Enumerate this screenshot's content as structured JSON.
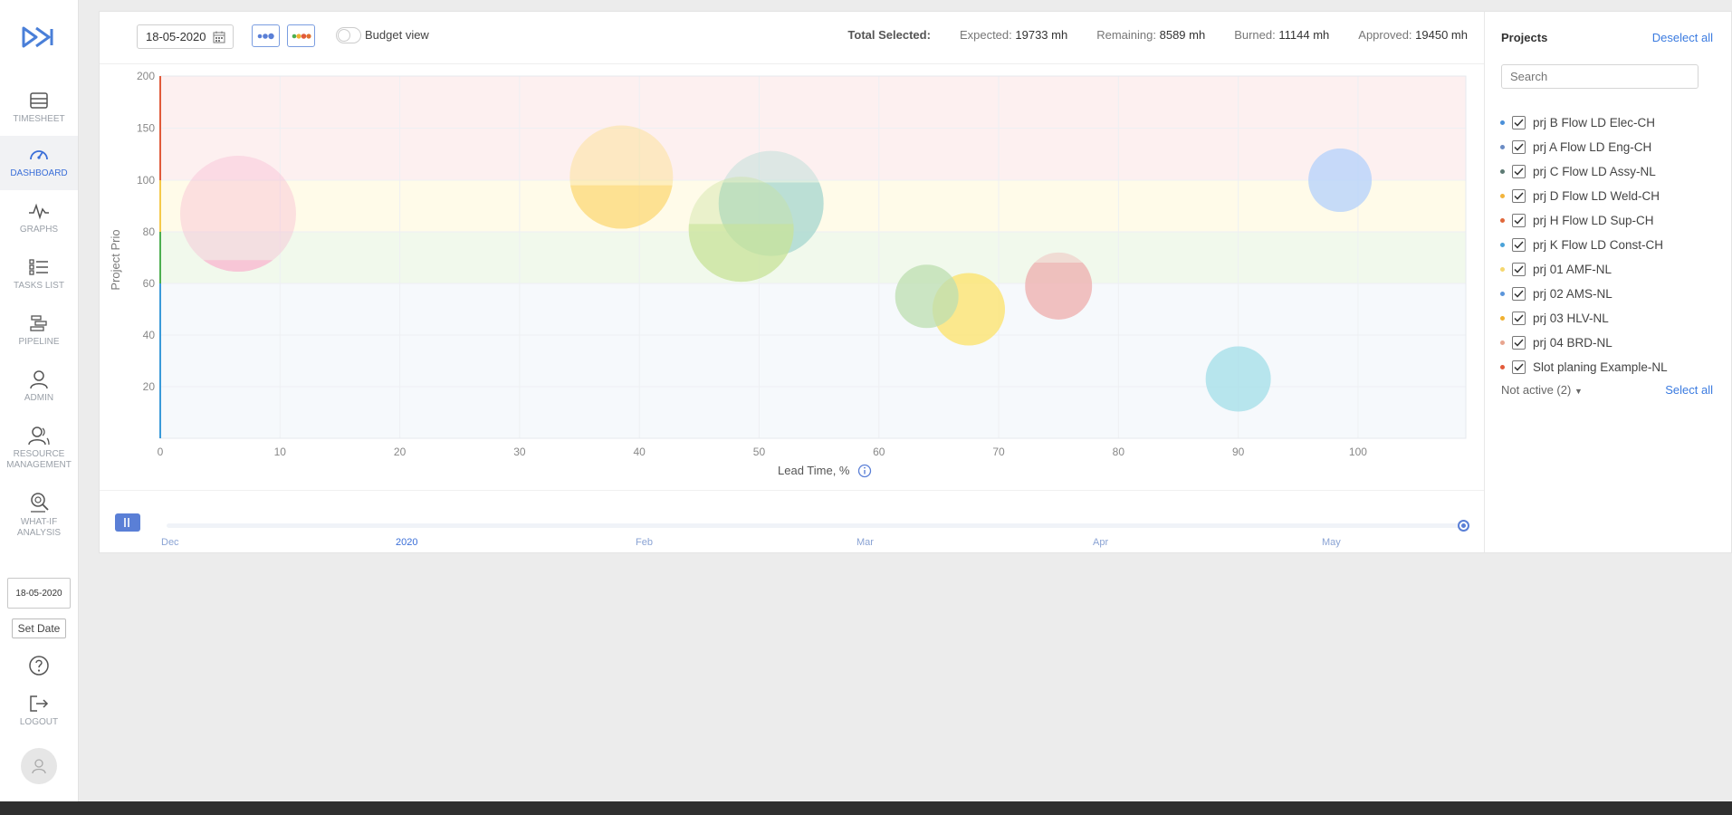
{
  "sidebar": {
    "items": [
      {
        "label": "TIMESHEET",
        "icon": "timesheet-icon"
      },
      {
        "label": "DASHBOARD",
        "icon": "dashboard-icon"
      },
      {
        "label": "GRAPHS",
        "icon": "graphs-icon"
      },
      {
        "label": "TASKS LIST",
        "icon": "tasks-list-icon"
      },
      {
        "label": "PIPELINE",
        "icon": "pipeline-icon"
      },
      {
        "label": "ADMIN",
        "icon": "admin-icon"
      },
      {
        "label": "RESOURCE MANAGEMENT",
        "icon": "resource-management-icon"
      },
      {
        "label": "WHAT-IF ANALYSIS",
        "icon": "what-if-analysis-icon"
      }
    ],
    "active": "DASHBOARD",
    "date_value": "18-05-2020",
    "set_date_label": "Set Date",
    "logout_label": "LOGOUT"
  },
  "toolbar": {
    "date_value": "18-05-2020",
    "budget_view_label": "Budget view",
    "budget_view_on": false,
    "total_selected_label": "Total Selected:",
    "expected_label": "Expected:",
    "expected_value": "19733 mh",
    "remaining_label": "Remaining:",
    "remaining_value": "8589 mh",
    "burned_label": "Burned:",
    "burned_value": "11144 mh",
    "approved_label": "Approved:",
    "approved_value": "19450 mh"
  },
  "chart_data": {
    "type": "scatter",
    "xlabel": "Lead Time, %",
    "ylabel": "Project Prio",
    "xlim": [
      0,
      109
    ],
    "ylim": [
      0,
      200
    ],
    "xticks": [
      0,
      10,
      20,
      30,
      40,
      50,
      60,
      70,
      80,
      90,
      100
    ],
    "yticks": [
      20,
      40,
      60,
      80,
      100,
      150,
      200
    ],
    "bands": [
      {
        "from": 100,
        "to": 200,
        "color": "#fdf0f0"
      },
      {
        "from": 80,
        "to": 100,
        "color": "#fffbe9"
      },
      {
        "from": 60,
        "to": 80,
        "color": "#f1f9ec"
      },
      {
        "from": 0,
        "to": 60,
        "color": "#f6f9fc"
      }
    ],
    "points": [
      {
        "x": 6.5,
        "y": 87,
        "r": 64,
        "color": "#f8b6cf",
        "fill_level": 0.1
      },
      {
        "x": 38.5,
        "y": 103,
        "r": 57,
        "color": "#fcd977",
        "fill_level": 0.42
      },
      {
        "x": 51,
        "y": 91,
        "r": 58,
        "color": "#a7d7cf",
        "fill_level": 0.7
      },
      {
        "x": 48.5,
        "y": 81,
        "r": 58,
        "color": "#c8e39a",
        "fill_level": 0.55
      },
      {
        "x": 67.5,
        "y": 50,
        "r": 40,
        "color": "#fde36b",
        "fill_level": 1.0
      },
      {
        "x": 64,
        "y": 55,
        "r": 35,
        "color": "#bedfb2",
        "fill_level": 1.0
      },
      {
        "x": 75,
        "y": 59,
        "r": 37,
        "color": "#eeaeae",
        "fill_level": 0.85
      },
      {
        "x": 98.5,
        "y": 100,
        "r": 35,
        "color": "#b5d2fb",
        "fill_level": 1.0
      },
      {
        "x": 90,
        "y": 23,
        "r": 36,
        "color": "#a4dfe9",
        "fill_level": 1.0
      }
    ]
  },
  "timeline": {
    "labels": [
      "Dec",
      "2020",
      "Feb",
      "Mar",
      "Apr",
      "May"
    ]
  },
  "panel": {
    "title": "Projects",
    "deselect_all": "Deselect all",
    "search_placeholder": "Search",
    "projects": [
      {
        "name": "prj B Flow LD Elec-CH",
        "color": "#4a90d9",
        "checked": true
      },
      {
        "name": "prj A Flow LD Eng-CH",
        "color": "#6a8bc4",
        "checked": true
      },
      {
        "name": "prj C Flow LD Assy-NL",
        "color": "#5c7a73",
        "checked": true
      },
      {
        "name": "prj D Flow LD Weld-CH",
        "color": "#f2b43c",
        "checked": true
      },
      {
        "name": "prj H Flow LD Sup-CH",
        "color": "#e0683b",
        "checked": true
      },
      {
        "name": "prj K Flow LD Const-CH",
        "color": "#4aa3d9",
        "checked": true
      },
      {
        "name": "prj 01 AMF-NL",
        "color": "#f5d76e",
        "checked": true
      },
      {
        "name": "prj 02 AMS-NL",
        "color": "#5b95db",
        "checked": true
      },
      {
        "name": "prj 03 HLV-NL",
        "color": "#f0b030",
        "checked": true
      },
      {
        "name": "prj 04 BRD-NL",
        "color": "#e8a58f",
        "checked": true
      },
      {
        "name": "Slot planing Example-NL",
        "color": "#e25a3a",
        "checked": true
      }
    ],
    "not_active_label": "Not active (2)",
    "select_all": "Select all"
  }
}
